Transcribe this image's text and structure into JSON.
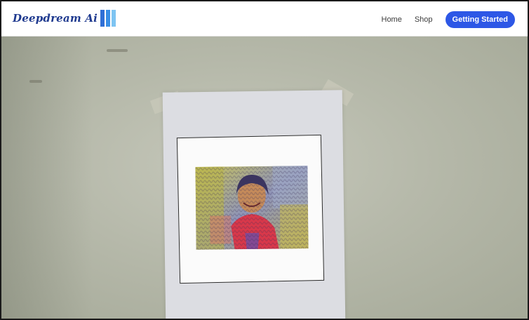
{
  "app": {
    "brand_name": "Deepdream Ai",
    "brand_bar_colors": [
      "#2f6fd6",
      "#3a8fe6",
      "#7ec4f2"
    ]
  },
  "nav": {
    "links": [
      "Home",
      "Shop"
    ],
    "cta_label": "Getting Started",
    "cta_color": "#2d57e6"
  },
  "camera_view": {
    "background_color": "#b8bbae",
    "paper_color": "#dcdde2",
    "card_color": "#fbfbfb"
  }
}
